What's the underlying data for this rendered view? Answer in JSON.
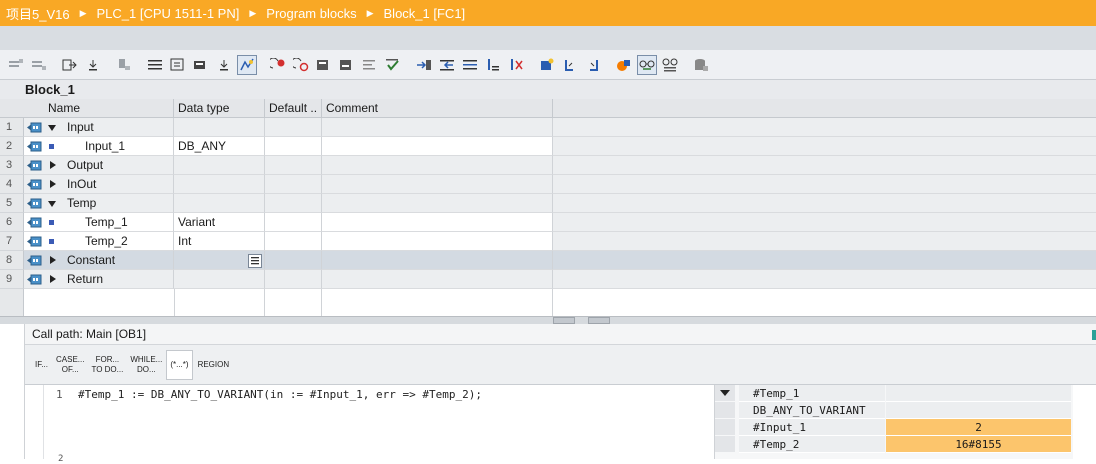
{
  "breadcrumb": [
    "项目5_V16",
    "PLC_1 [CPU 1511-1 PN]",
    "Program blocks",
    "Block_1 [FC1]"
  ],
  "toolbar": {
    "icons": [
      "insert-network-icon",
      "delete-network-icon",
      "export-icon",
      "import-icon",
      "absolute-address-icon",
      "list-icon",
      "comment-icon",
      "download-icon",
      "monitor-toggle-icon",
      "set-breakpoint-icon",
      "clear-breakpoint-icon",
      "go-to-icon",
      "step-icon",
      "compare-icon",
      "checkmark-icon",
      "indent-icon",
      "outdent-icon",
      "format-icon",
      "sort-icon",
      "reorder-icon",
      "bookmark-icon",
      "bookmark-prev-icon",
      "bookmark-next-icon",
      "palette-icon",
      "glasses-monitor-icon",
      "watch-icon",
      "database-icon"
    ]
  },
  "block": {
    "title": "Block_1"
  },
  "interface": {
    "columns": [
      "Name",
      "Data type",
      "Default ..",
      "Comment"
    ],
    "rows": [
      {
        "num": "1",
        "name": "Input",
        "type": "",
        "expander": "down",
        "indent": 0
      },
      {
        "num": "2",
        "name": "Input_1",
        "type": "DB_ANY",
        "expander": "none",
        "indent": 1
      },
      {
        "num": "3",
        "name": "Output",
        "type": "",
        "expander": "right",
        "indent": 0
      },
      {
        "num": "4",
        "name": "InOut",
        "type": "",
        "expander": "right",
        "indent": 0
      },
      {
        "num": "5",
        "name": "Temp",
        "type": "",
        "expander": "down",
        "indent": 0
      },
      {
        "num": "6",
        "name": "Temp_1",
        "type": "Variant",
        "expander": "none",
        "indent": 1
      },
      {
        "num": "7",
        "name": "Temp_2",
        "type": "Int",
        "expander": "none",
        "indent": 1
      },
      {
        "num": "8",
        "name": "Constant",
        "type": "",
        "expander": "right",
        "indent": 0
      },
      {
        "num": "9",
        "name": "Return",
        "type": "",
        "expander": "right",
        "indent": 0
      }
    ]
  },
  "editor": {
    "call_path": "Call path: Main [OB1]",
    "scl_buttons": [
      "IF...",
      "CASE...\nOF...",
      "FOR...\nTO DO...",
      "WHILE...\nDO...",
      "(*...*)",
      "REGION"
    ],
    "code": {
      "line_number": "1",
      "text": "#Temp_1 := DB_ANY_TO_VARIANT(in := #Input_1, err => #Temp_2);",
      "next_line_number": "2"
    }
  },
  "watch": {
    "rows": [
      {
        "name": "#Temp_1",
        "value": ""
      },
      {
        "name": "DB_ANY_TO_VARIANT",
        "value": ""
      },
      {
        "name": "#Input_1",
        "value": "2"
      },
      {
        "name": "#Temp_2",
        "value": "16#8155"
      }
    ],
    "highlight_color": "#fcc56c"
  },
  "colors": {
    "breadcrumb_bg": "#f9a825",
    "selected_row": "#d3dae2"
  }
}
